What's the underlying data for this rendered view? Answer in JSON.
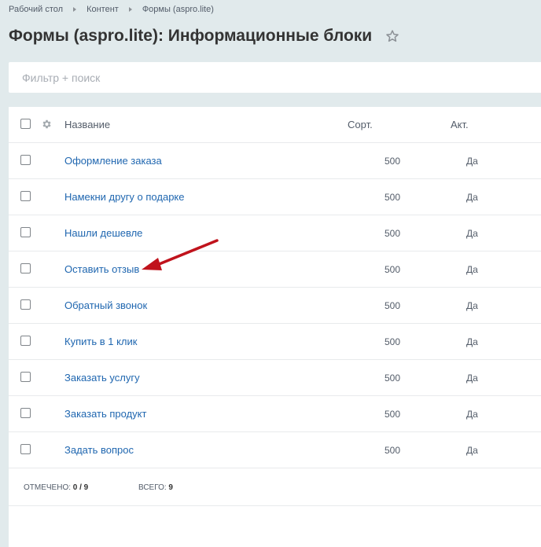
{
  "breadcrumb": [
    {
      "label": "Рабочий стол"
    },
    {
      "label": "Контент"
    },
    {
      "label": "Формы (aspro.lite)"
    }
  ],
  "page_title": "Формы (aspro.lite): Информационные блоки",
  "filter": {
    "placeholder": "Фильтр + поиск",
    "value": ""
  },
  "grid": {
    "headers": {
      "name": "Название",
      "sort": "Сорт.",
      "active": "Акт."
    },
    "rows": [
      {
        "name": "Оформление заказа",
        "sort": "500",
        "active": "Да"
      },
      {
        "name": "Намекни другу о подарке",
        "sort": "500",
        "active": "Да"
      },
      {
        "name": "Нашли дешевле",
        "sort": "500",
        "active": "Да"
      },
      {
        "name": "Оставить отзыв",
        "sort": "500",
        "active": "Да"
      },
      {
        "name": "Обратный звонок",
        "sort": "500",
        "active": "Да"
      },
      {
        "name": "Купить в 1 клик",
        "sort": "500",
        "active": "Да"
      },
      {
        "name": "Заказать услугу",
        "sort": "500",
        "active": "Да"
      },
      {
        "name": "Заказать продукт",
        "sort": "500",
        "active": "Да"
      },
      {
        "name": "Задать вопрос",
        "sort": "500",
        "active": "Да"
      }
    ],
    "footer": {
      "selected_label": "Отмечено:",
      "selected_value": "0 / 9",
      "total_label": "Всего:",
      "total_value": "9"
    }
  },
  "icons": {
    "favorite": "star-outline-icon",
    "settings": "gear-icon",
    "annotation": "red-arrow-icon"
  },
  "colors": {
    "link": "#2067b0",
    "background": "#e1eaec",
    "arrow": "#c0131c"
  }
}
